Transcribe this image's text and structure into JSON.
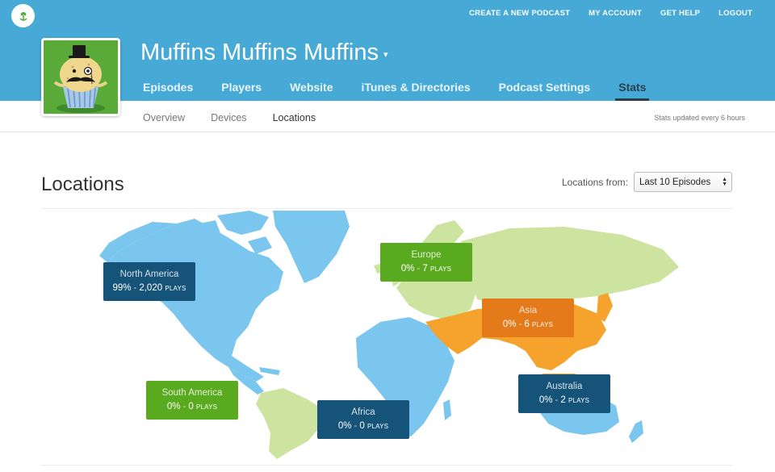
{
  "topnav": {
    "create_podcast": "CREATE A NEW PODCAST",
    "my_account": "MY ACCOUNT",
    "get_help": "GET HELP",
    "logout": "LOGOUT"
  },
  "podcast": {
    "title": "Muffins Muffins Muffins",
    "caret": "▾"
  },
  "tabs": [
    "Episodes",
    "Players",
    "Website",
    "iTunes & Directories",
    "Podcast Settings",
    "Stats"
  ],
  "active_tab": "Stats",
  "subtabs": [
    "Overview",
    "Devices",
    "Locations"
  ],
  "active_subtab": "Locations",
  "updated_text": "Stats updated every 6 hours",
  "page_title": "Locations",
  "filter": {
    "label": "Locations from:",
    "selected": "Last 10 Episodes"
  },
  "regions": {
    "north_america": {
      "name": "North America",
      "percent": "99%",
      "plays": "2,020",
      "unit": "PLAYS"
    },
    "europe": {
      "name": "Europe",
      "percent": "0%",
      "plays": "7",
      "unit": "PLAYS"
    },
    "asia": {
      "name": "Asia",
      "percent": "0%",
      "plays": "6",
      "unit": "PLAYS"
    },
    "south_america": {
      "name": "South America",
      "percent": "0%",
      "plays": "0",
      "unit": "PLAYS"
    },
    "africa": {
      "name": "Africa",
      "percent": "0%",
      "plays": "0",
      "unit": "PLAYS"
    },
    "australia": {
      "name": "Australia",
      "percent": "0%",
      "plays": "2",
      "unit": "PLAYS"
    }
  },
  "colors": {
    "header": "#46a9d6",
    "active_tab": "#2b3e4f",
    "map_high": "#7ac6ee",
    "map_mid": "#f5a32c",
    "map_low": "#cde3a0",
    "label_navy": "#165379",
    "label_green": "#5aaa1f",
    "label_orange": "#e57a1a"
  }
}
